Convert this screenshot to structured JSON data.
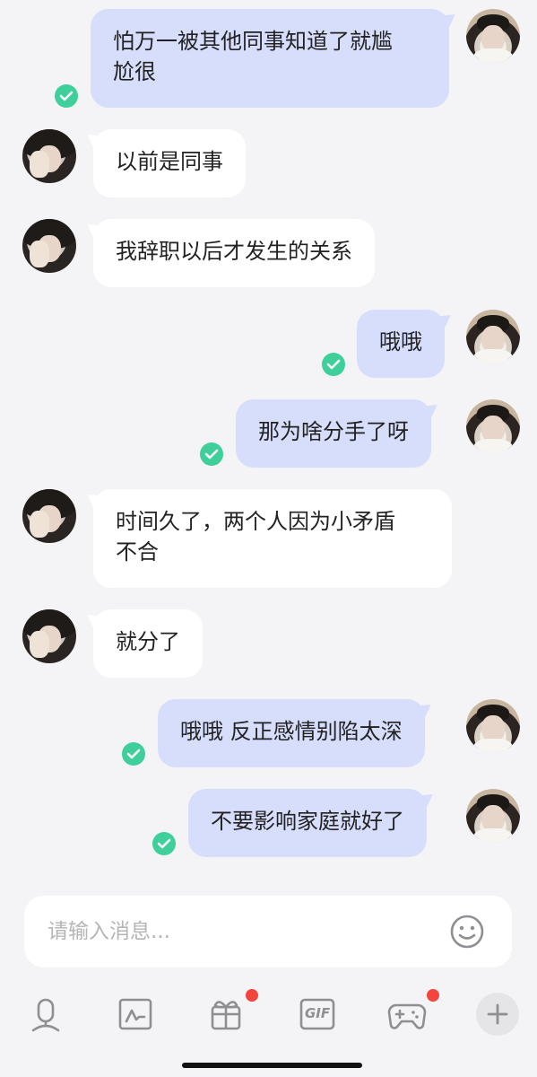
{
  "messages": [
    {
      "side": "right",
      "text": "怕万一被其他同事知道了就尴\n尬很",
      "read": true
    },
    {
      "side": "left",
      "text": "以前是同事"
    },
    {
      "side": "left",
      "text": "我辞职以后才发生的关系"
    },
    {
      "side": "right",
      "text": "哦哦",
      "read": true
    },
    {
      "side": "right",
      "text": "那为啥分手了呀",
      "read": true
    },
    {
      "side": "left",
      "text": "时间久了，两个人因为小矛盾\n不合"
    },
    {
      "side": "left",
      "text": "就分了"
    },
    {
      "side": "right",
      "text": "哦哦 反正感情别陷太深",
      "read": true
    },
    {
      "side": "right",
      "text": "不要影响家庭就好了",
      "read": true
    }
  ],
  "input": {
    "placeholder": "请输入消息...",
    "value": ""
  },
  "toolbar": {
    "icons": [
      "microphone-icon",
      "image-icon",
      "gift-icon",
      "gif-icon",
      "gamepad-icon",
      "plus-icon"
    ],
    "gif_label": "GIF",
    "badges": {
      "gift": true,
      "gamepad": true
    }
  },
  "colors": {
    "bubble_self": "#d6defc",
    "bubble_other": "#ffffff",
    "read_check": "#3ecf9b",
    "badge": "#f2453d"
  }
}
